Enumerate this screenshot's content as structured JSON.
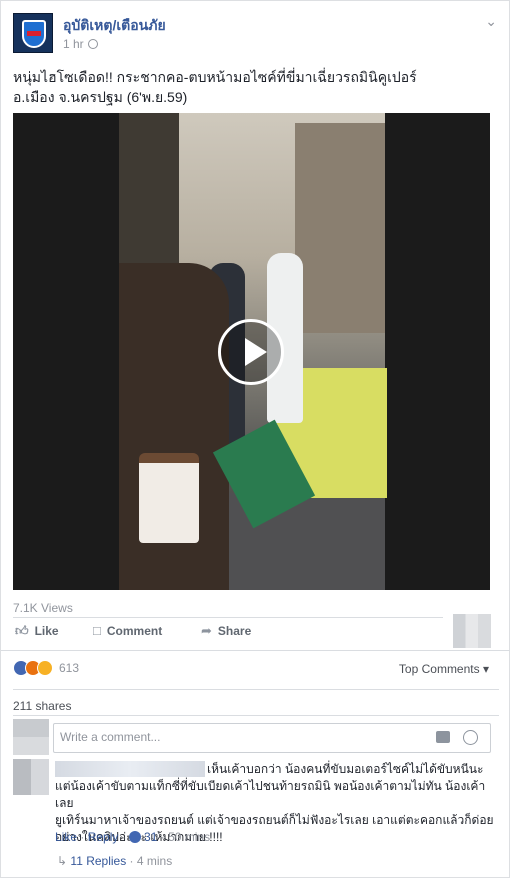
{
  "post": {
    "page_name": "อุบัติเหตุ/เตือนภัย",
    "time": "1 hr",
    "text_line1": "หนุ่มไฮโซเดือด!! กระชากคอ-ตบหน้ามอไซค์ที่ขี่มาเฉี่ยวรถมินิคูเปอร์",
    "text_line2": "อ.เมือง จ.นครปฐม (6'พ.ย.59)",
    "views": "7.1K Views"
  },
  "actions": {
    "like": "Like",
    "comment": "Comment",
    "share": "Share"
  },
  "reactions": {
    "count": "613",
    "top_comments": "Top Comments"
  },
  "shares": "211 shares",
  "comment_input": {
    "placeholder": "Write a comment..."
  },
  "comment": {
    "text_line1": "เห็นเค้าบอกว่า น้องคนที่ขับมอเตอร์ไซค์ไม่ได้ขับหนีนะ",
    "text_line2": "แต่น้องเค้าขับตามแท็กซี่ที่ขับเบียดเค้าไปชนท้ายรถมินิ พอน้องเค้าตามไม่ทัน น้องเค้าเลย",
    "text_line3": "ยูเทิร์นมาหาเจ้าของรถยนต์ แต่เจ้าของรถยนต์ก็ไม่ฟังอะไรเลย เอาแต่ตะคอกแล้วก็ด่อย",
    "text_line4": "อย่างในคลิปอ่ะคะ เห้มากมาย !!!!",
    "like": "Like",
    "reply": "Reply",
    "likes": "31",
    "time": "50 mins",
    "replies": "11 Replies",
    "replies_time": "4 mins"
  },
  "colors": {
    "link": "#365899",
    "muted": "#90949c",
    "like_blue": "#4267b2"
  }
}
